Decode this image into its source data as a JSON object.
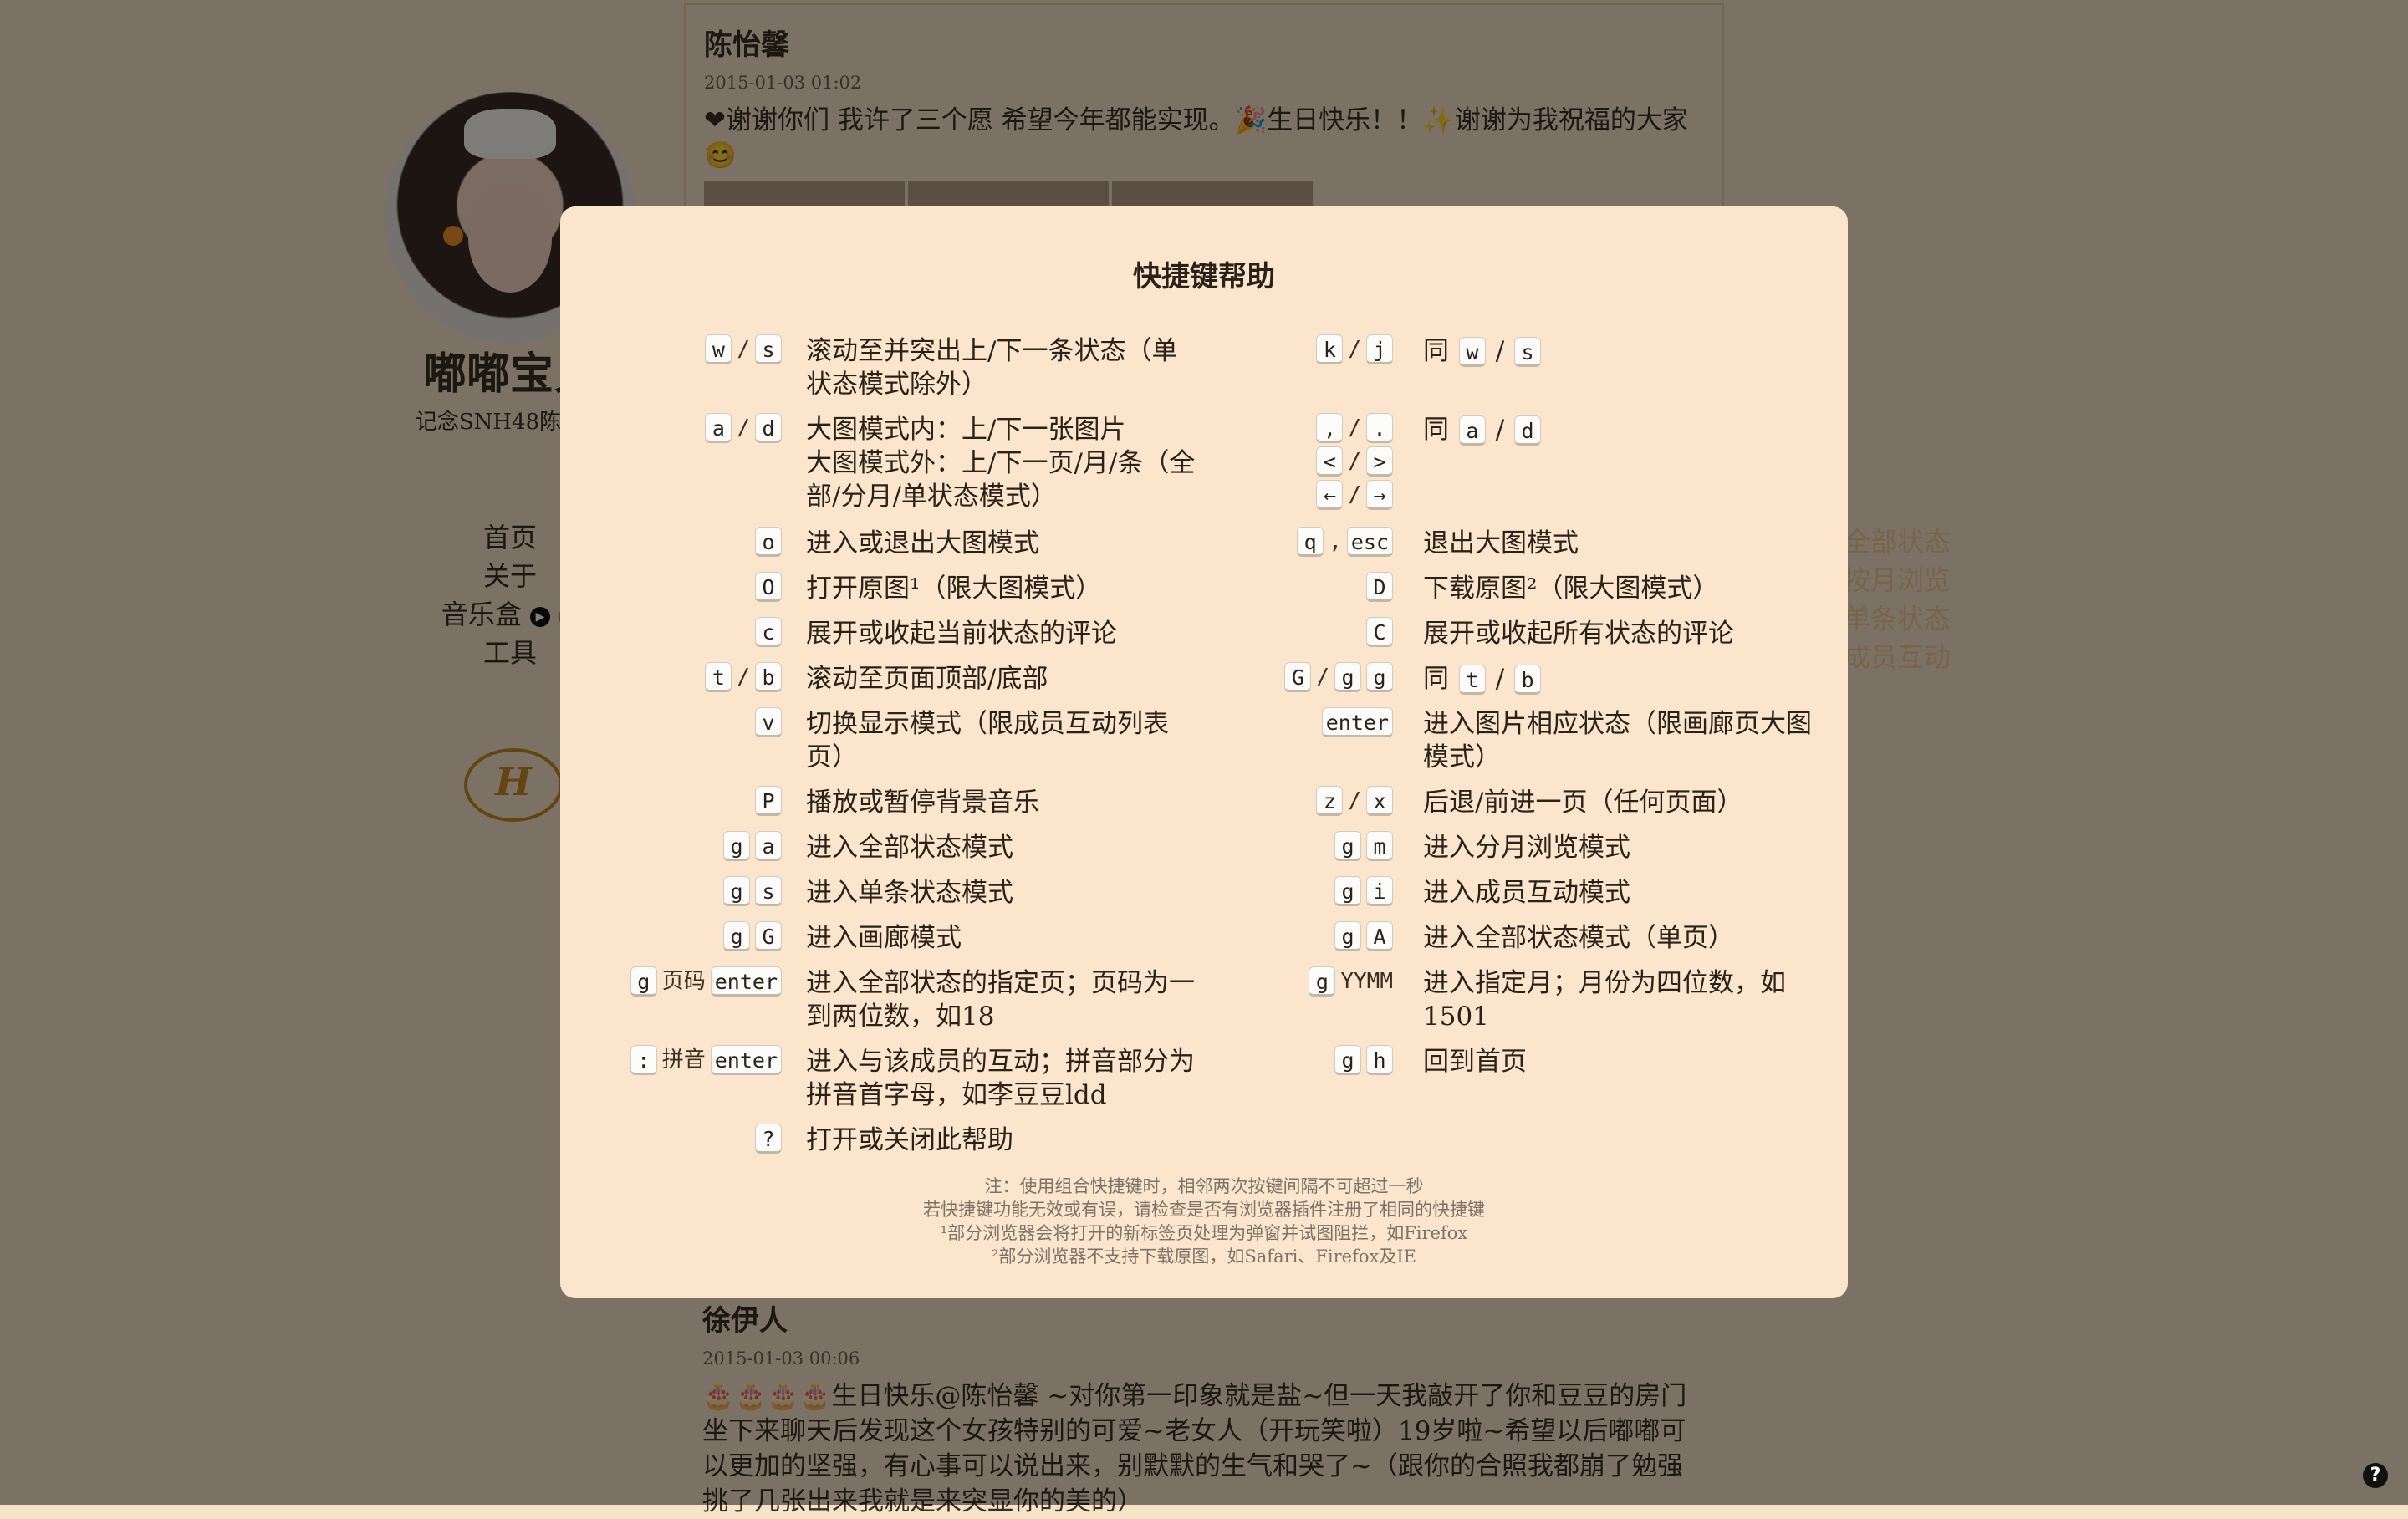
{
  "sidebar": {
    "title": "嘟嘟宝贝",
    "subtitle": "记念SNH48陈怡馨",
    "nav": [
      "首页",
      "关于",
      "音乐盒",
      "工具"
    ],
    "play_icon": "play-icon",
    "next_icon": "next-icon",
    "logo_letter": "H"
  },
  "right_links": [
    "全部状态",
    "按月浏览",
    "单条状态",
    "成员互动"
  ],
  "feed": [
    {
      "name": "陈怡馨",
      "time": "2015-01-03 01:02",
      "text": "❤谢谢你们 我许了三个愿 希望今年都能实现。🎉生日快乐！！✨谢谢为我祝福的大家😊"
    },
    {
      "name": "徐伊人",
      "time": "2015-01-03 00:06",
      "text": "🎂🎂🎂🎂生日快乐@陈怡馨 ~对你第一印象就是盐~但一天我敲开了你和豆豆的房门坐下来聊天后发现这个女孩特别的可爱~老女人（开玩笑啦）19岁啦~希望以后嘟嘟可以更加的坚强，有心事可以说出来，别默默的生气和哭了~（跟你的合照我都崩了勉强挑了几张出来我就是来突显你的美的）"
    }
  ],
  "help_modal": {
    "title": "快捷键帮助",
    "rows": [
      {
        "left_keys": [
          "w",
          "/",
          "s"
        ],
        "left_desc": "滚动至并突出上/下一条状态（单状态模式除外）",
        "right_keys": [
          "k",
          "/",
          "j"
        ],
        "right_desc_prefix": "同",
        "right_desc_keys": [
          "w",
          "/",
          "s"
        ]
      },
      {
        "left_keys": [
          "a",
          "/",
          "d"
        ],
        "left_desc": "大图模式内：上/下一张图片\n大图模式外：上/下一页/月/条（全部/分月/单状态模式）",
        "right_keys": [
          ",",
          "/",
          "."
        ],
        "right_keys2": [
          "<",
          "/",
          ">"
        ],
        "right_keys3": [
          "←",
          "/",
          "→"
        ],
        "right_desc_prefix": "同",
        "right_desc_keys": [
          "a",
          "/",
          "d"
        ]
      },
      {
        "left_keys": [
          "o"
        ],
        "left_desc": "进入或退出大图模式",
        "right_keys": [
          "q",
          ",",
          "esc"
        ],
        "right_desc": "退出大图模式"
      },
      {
        "left_keys": [
          "O"
        ],
        "left_desc": "打开原图¹（限大图模式）",
        "right_keys": [
          "D"
        ],
        "right_desc": "下载原图²（限大图模式）"
      },
      {
        "left_keys": [
          "c"
        ],
        "left_desc": "展开或收起当前状态的评论",
        "right_keys": [
          "C"
        ],
        "right_desc": "展开或收起所有状态的评论"
      },
      {
        "left_keys": [
          "t",
          "/",
          "b"
        ],
        "left_desc": "滚动至页面顶部/底部",
        "right_keys": [
          "G",
          "/",
          "g",
          "g"
        ],
        "right_desc_prefix": "同",
        "right_desc_keys": [
          "t",
          "/",
          "b"
        ]
      },
      {
        "left_keys": [
          "v"
        ],
        "left_desc": "切换显示模式（限成员互动列表页）",
        "right_keys": [
          "enter"
        ],
        "right_desc": "进入图片相应状态（限画廊页大图模式）"
      },
      {
        "left_keys": [
          "P"
        ],
        "left_desc": "播放或暂停背景音乐",
        "right_keys": [
          "z",
          "/",
          "x"
        ],
        "right_desc": "后退/前进一页（任何页面）"
      },
      {
        "left_keys": [
          "g",
          "a"
        ],
        "left_desc": "进入全部状态模式",
        "right_keys": [
          "g",
          "m"
        ],
        "right_desc": "进入分月浏览模式"
      },
      {
        "left_keys": [
          "g",
          "s"
        ],
        "left_desc": "进入单条状态模式",
        "right_keys": [
          "g",
          "i"
        ],
        "right_desc": "进入成员互动模式"
      },
      {
        "left_keys": [
          "g",
          "G"
        ],
        "left_desc": "进入画廊模式",
        "right_keys": [
          "g",
          "A"
        ],
        "right_desc": "进入全部状态模式（单页）"
      },
      {
        "left_keys": [
          "g",
          "页码",
          "enter"
        ],
        "left_desc": "进入全部状态的指定页；页码为一到两位数，如18",
        "right_keys": [
          "g",
          "YYMM"
        ],
        "right_desc": "进入指定月；月份为四位数，如1501"
      },
      {
        "left_keys": [
          ":",
          "拼音",
          "enter"
        ],
        "left_desc": "进入与该成员的互动；拼音部分为拼音首字母，如李豆豆ldd",
        "right_keys": [
          "g",
          "h"
        ],
        "right_desc": "回到首页"
      },
      {
        "left_keys": [
          "?"
        ],
        "left_desc": "打开或关闭此帮助"
      }
    ],
    "notes": [
      "注：使用组合快捷键时，相邻两次按键间隔不可超过一秒",
      "若快捷键功能无效或有误，请检查是否有浏览器插件注册了相同的快捷键",
      "¹部分浏览器会将打开的新标签页处理为弹窗并试图阻拦，如Firefox",
      "²部分浏览器不支持下载原图，如Safari、Firefox及IE"
    ]
  },
  "help_button": "?"
}
